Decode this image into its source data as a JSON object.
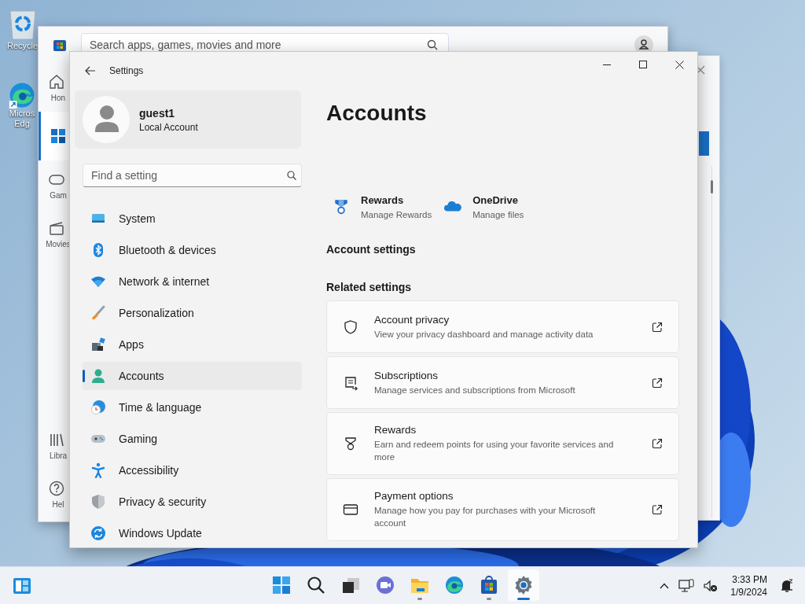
{
  "desktop": {
    "icons": [
      {
        "kind": "recycle-bin",
        "lines": [
          "Recycle"
        ]
      },
      {
        "kind": "edge",
        "lines": [
          "Micros",
          "Edg"
        ]
      }
    ]
  },
  "store_window": {
    "search": {
      "placeholder": "Search apps, games, movies and more"
    },
    "nav": [
      {
        "kind": "home",
        "label": "Hon",
        "selected": false
      },
      {
        "kind": "apps",
        "selected": true
      },
      {
        "kind": "gaming",
        "label": "Gam",
        "selected": false
      },
      {
        "kind": "movies",
        "label": "Movies",
        "selected": false
      },
      {
        "kind": "library",
        "label": "Libra",
        "selected": false
      },
      {
        "kind": "help",
        "label": "Hel",
        "selected": false
      }
    ]
  },
  "settings_window": {
    "title": "Settings",
    "profile": {
      "name": "guest1",
      "account_type": "Local Account"
    },
    "search": {
      "placeholder": "Find a setting"
    },
    "nav": [
      {
        "kind": "system",
        "label": "System",
        "selected": false
      },
      {
        "kind": "bluetooth",
        "label": "Bluetooth & devices",
        "selected": false
      },
      {
        "kind": "network",
        "label": "Network & internet",
        "selected": false
      },
      {
        "kind": "personalization",
        "label": "Personalization",
        "selected": false
      },
      {
        "kind": "apps",
        "label": "Apps",
        "selected": false
      },
      {
        "kind": "accounts",
        "label": "Accounts",
        "selected": true
      },
      {
        "kind": "time",
        "label": "Time & language",
        "selected": false
      },
      {
        "kind": "gaming",
        "label": "Gaming",
        "selected": false
      },
      {
        "kind": "accessibility",
        "label": "Accessibility",
        "selected": false
      },
      {
        "kind": "privacy",
        "label": "Privacy & security",
        "selected": false
      },
      {
        "kind": "update",
        "label": "Windows Update",
        "selected": false
      }
    ],
    "page_title": "Accounts",
    "services": [
      {
        "kind": "rewards",
        "title": "Rewards",
        "subtitle": "Manage Rewards"
      },
      {
        "kind": "onedrive",
        "title": "OneDrive",
        "subtitle": "Manage files"
      }
    ],
    "sections": [
      {
        "heading": "Account settings"
      },
      {
        "heading": "Related settings",
        "cards": [
          {
            "kind": "shield",
            "title": "Account privacy",
            "description": "View your privacy dashboard and manage activity data"
          },
          {
            "kind": "subscriptions",
            "title": "Subscriptions",
            "description": "Manage services and subscriptions from Microsoft"
          },
          {
            "kind": "medal",
            "title": "Rewards",
            "description": "Earn and redeem points for using your favorite services and more"
          },
          {
            "kind": "card",
            "title": "Payment options",
            "description": "Manage how you pay for purchases with your Microsoft account"
          }
        ]
      }
    ]
  },
  "taskbar": {
    "apps": [
      {
        "kind": "start",
        "running": false,
        "active": false
      },
      {
        "kind": "search",
        "running": false,
        "active": false
      },
      {
        "kind": "task-view",
        "running": false,
        "active": false
      },
      {
        "kind": "chat",
        "running": false,
        "active": false
      },
      {
        "kind": "file-explorer",
        "running": true,
        "active": false
      },
      {
        "kind": "edge",
        "running": false,
        "active": false
      },
      {
        "kind": "store",
        "running": true,
        "active": false
      },
      {
        "kind": "settings",
        "running": true,
        "active": true
      }
    ],
    "clock": {
      "time": "3:33 PM",
      "date": "1/9/2024"
    }
  }
}
